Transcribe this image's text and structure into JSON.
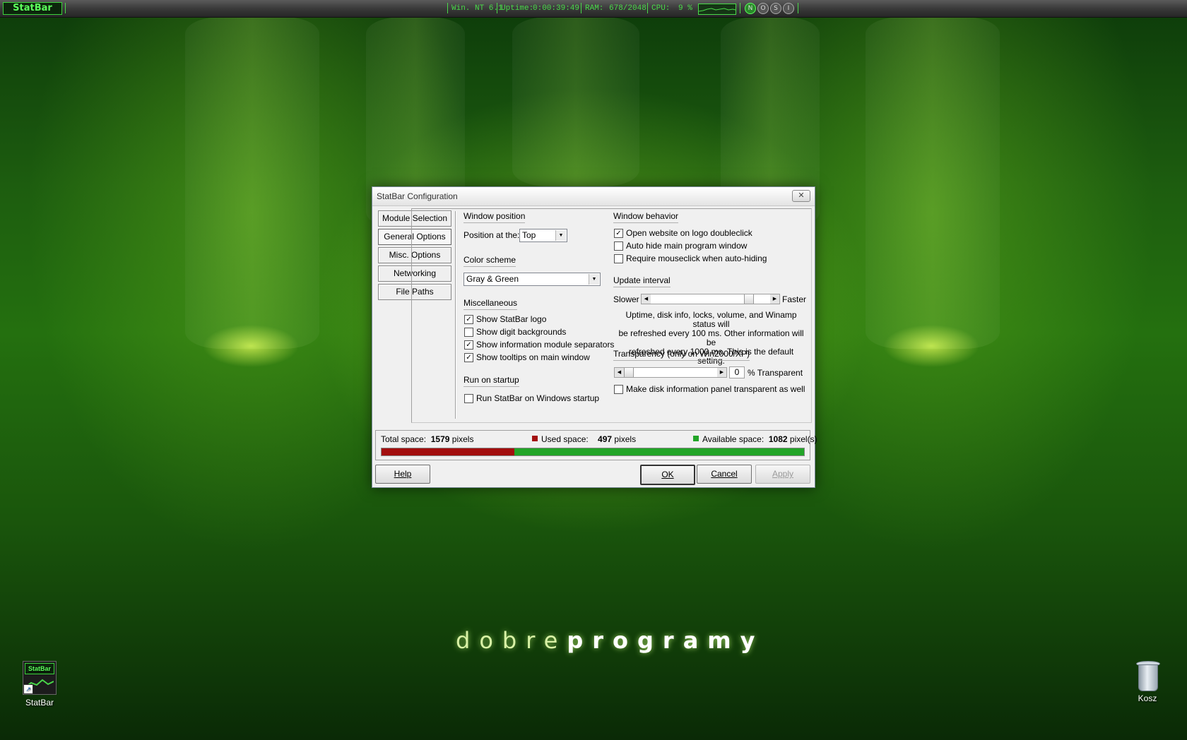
{
  "taskbar": {
    "logo": "StatBar",
    "os": "Win. NT 6.1",
    "uptime_label": "Uptime:",
    "uptime_value": "0:00:39:49",
    "ram_label": "RAM:",
    "ram_value": "678/2048",
    "cpu_label": "CPU:",
    "cpu_value": "9 %",
    "buttons": [
      "N",
      "O",
      "S",
      "I"
    ]
  },
  "desktop": {
    "brand_light": "dobre",
    "brand_bold": "programy",
    "icons": [
      {
        "label": "StatBar",
        "icon": "statbar-app-icon"
      },
      {
        "label": "Kosz",
        "icon": "recycle-bin-icon"
      }
    ]
  },
  "dialog": {
    "title": "StatBar Configuration",
    "close_glyph": "✕",
    "tabs": [
      "Module Selection",
      "General Options",
      "Misc. Options",
      "Networking",
      "File Paths"
    ],
    "active_tab": "General Options",
    "window_position": {
      "label": "Window position",
      "field_label": "Position at the:",
      "value": "Top"
    },
    "color_scheme": {
      "label": "Color scheme",
      "value": "Gray & Green"
    },
    "miscellaneous": {
      "label": "Miscellaneous",
      "items": [
        {
          "label": "Show StatBar logo",
          "checked": true
        },
        {
          "label": "Show digit backgrounds",
          "checked": false
        },
        {
          "label": "Show information module separators",
          "checked": true
        },
        {
          "label": "Show tooltips on main window",
          "checked": true
        }
      ]
    },
    "run_on_startup": {
      "label": "Run on startup",
      "item": {
        "label": "Run StatBar on Windows startup",
        "checked": false
      }
    },
    "window_behavior": {
      "label": "Window behavior",
      "items": [
        {
          "label": "Open website on logo doubleclick",
          "checked": true
        },
        {
          "label": "Auto hide main program window",
          "checked": false
        },
        {
          "label": "Require mouseclick when auto-hiding",
          "checked": false
        }
      ]
    },
    "update_interval": {
      "label": "Update interval",
      "slower": "Slower",
      "faster": "Faster",
      "level": 0.85,
      "desc1": "Uptime, disk info, locks, volume, and Winamp status will",
      "desc2": "be refreshed every 100 ms. Other information will be",
      "desc3": "refreshed every 1000 ms. This is the default setting."
    },
    "transparency": {
      "label": "Transparency (only on Win2000/XP)",
      "value": "0",
      "suffix": "% Transparent",
      "level": 0.0,
      "panel_option": {
        "label": "Make disk information panel transparent as well",
        "checked": false
      }
    },
    "space": {
      "total_label": "Total space:",
      "total_value": "1579",
      "total_unit": "pixels",
      "used_label": "Used space:",
      "used_value": "497",
      "used_unit": "pixels",
      "available_label": "Available space:",
      "available_value": "1082",
      "available_unit": "pixel(s)",
      "used_fraction": 0.315,
      "used_color": "#a30f0f",
      "available_color": "#22a528"
    },
    "buttons": {
      "help": "Help",
      "ok": "OK",
      "cancel": "Cancel",
      "apply": "Apply"
    }
  }
}
